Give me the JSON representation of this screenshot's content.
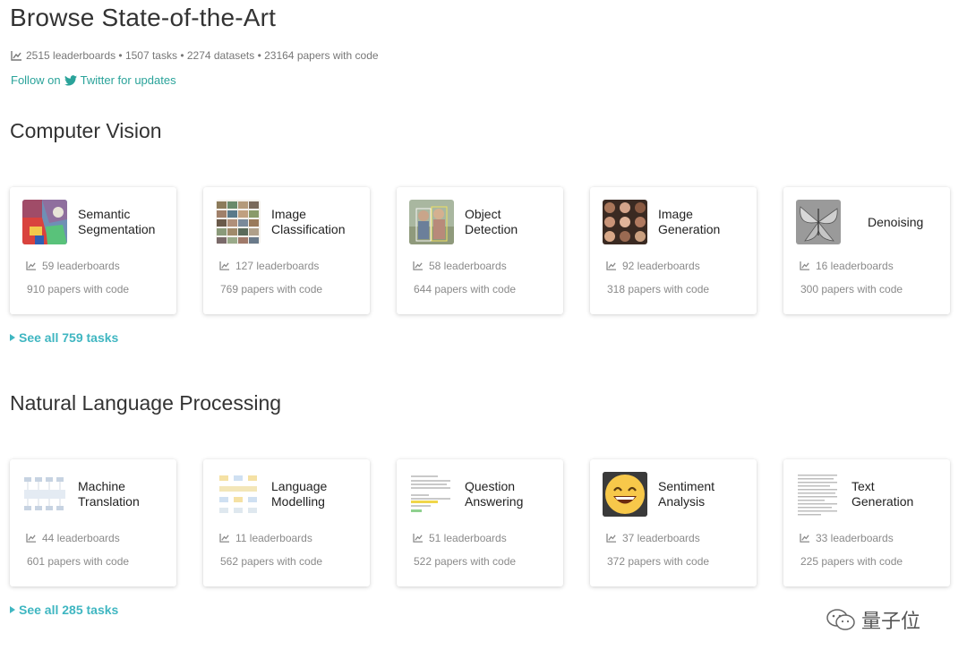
{
  "header": {
    "title": "Browse State-of-the-Art",
    "stats": "2515 leaderboards • 1507 tasks • 2274 datasets • 23164 papers with code",
    "follow_prefix": "Follow on",
    "follow_suffix": "Twitter for updates"
  },
  "cv": {
    "title": "Computer Vision",
    "see_all": "See all 759 tasks",
    "cards": [
      {
        "name_l1": "Semantic",
        "name_l2": "Segmentation",
        "leaderboards": "59 leaderboards",
        "papers": "910 papers with code"
      },
      {
        "name_l1": "Image",
        "name_l2": "Classification",
        "leaderboards": "127 leaderboards",
        "papers": "769 papers with code"
      },
      {
        "name_l1": "Object",
        "name_l2": "Detection",
        "leaderboards": "58 leaderboards",
        "papers": "644 papers with code"
      },
      {
        "name_l1": "Image",
        "name_l2": "Generation",
        "leaderboards": "92 leaderboards",
        "papers": "318 papers with code"
      },
      {
        "name_l1": "Denoising",
        "name_l2": "",
        "leaderboards": "16 leaderboards",
        "papers": "300 papers with code"
      }
    ]
  },
  "nlp": {
    "title": "Natural Language Processing",
    "see_all": "See all 285 tasks",
    "cards": [
      {
        "name_l1": "Machine",
        "name_l2": "Translation",
        "leaderboards": "44 leaderboards",
        "papers": "601 papers with code"
      },
      {
        "name_l1": "Language",
        "name_l2": "Modelling",
        "leaderboards": "11 leaderboards",
        "papers": "562 papers with code"
      },
      {
        "name_l1": "Question",
        "name_l2": "Answering",
        "leaderboards": "51 leaderboards",
        "papers": "522 papers with code"
      },
      {
        "name_l1": "Sentiment",
        "name_l2": "Analysis",
        "leaderboards": "37 leaderboards",
        "papers": "372 papers with code"
      },
      {
        "name_l1": "Text",
        "name_l2": "Generation",
        "leaderboards": "33 leaderboards",
        "papers": "225 papers with code"
      }
    ]
  },
  "watermark": {
    "text": "量子位"
  },
  "colors": {
    "accent": "#3fb6c1",
    "link": "#2aa39a",
    "muted": "#8a8a8a"
  }
}
